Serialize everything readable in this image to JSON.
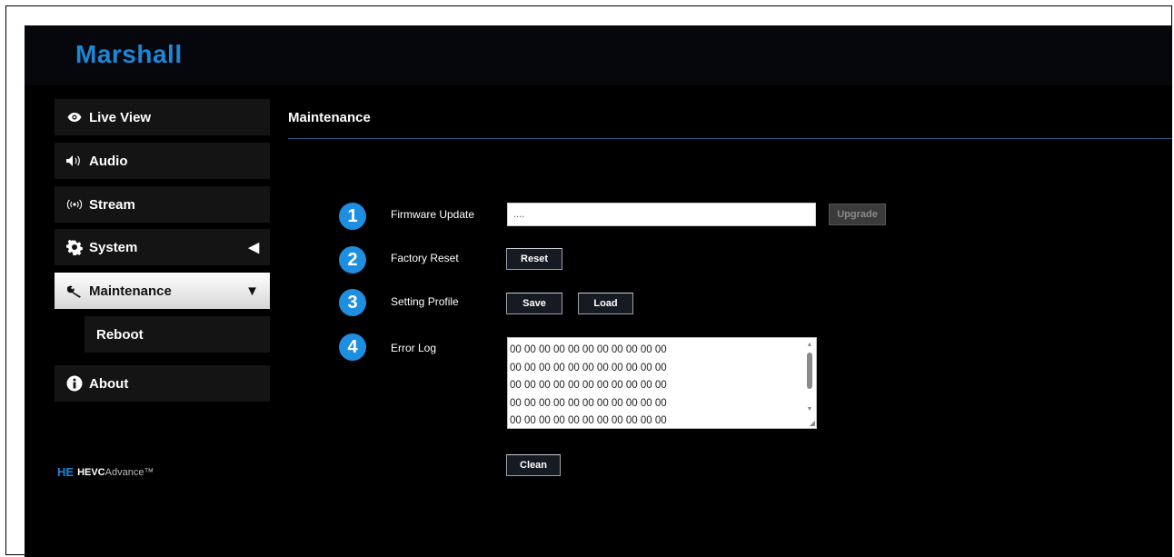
{
  "app": {
    "brand": "Marshall",
    "page_title": "Maintenance"
  },
  "sidebar": {
    "items": [
      {
        "label": "Live View",
        "icon": "eye-icon"
      },
      {
        "label": "Audio",
        "icon": "speaker-icon"
      },
      {
        "label": "Stream",
        "icon": "broadcast-icon"
      },
      {
        "label": "System",
        "icon": "gear-icon",
        "arrow": "◀"
      },
      {
        "label": "Maintenance",
        "icon": "wrench-icon",
        "arrow": "▼",
        "active": true
      },
      {
        "label": "About",
        "icon": "info-icon"
      }
    ],
    "sub_items": [
      {
        "label": "Reboot"
      }
    ]
  },
  "footer_logo": {
    "mark": "HE",
    "bold": "HEVC",
    "thin": "Advance™"
  },
  "rows": [
    {
      "number": "1",
      "label": "Firmware Update"
    },
    {
      "number": "2",
      "label": "Factory Reset"
    },
    {
      "number": "3",
      "label": "Setting Profile"
    },
    {
      "number": "4",
      "label": "Error Log"
    }
  ],
  "firmware": {
    "input_value": "....",
    "upgrade_label": "Upgrade"
  },
  "factory_reset": {
    "reset_label": "Reset"
  },
  "profile": {
    "save_label": "Save",
    "load_label": "Load"
  },
  "error_log": {
    "lines": "00 00 00 00 00 00 00 00 00 00 00\n00 00 00 00 00 00 00 00 00 00 00\n00 00 00 00 00 00 00 00 00 00 00\n00 00 00 00 00 00 00 00 00 00 00\n00 00 00 00 00 00 00 00 00 00 00",
    "clean_label": "Clean"
  },
  "colors": {
    "accent": "#1e8fe0",
    "brand": "#1e86d6",
    "rule": "#2f5a8a"
  }
}
